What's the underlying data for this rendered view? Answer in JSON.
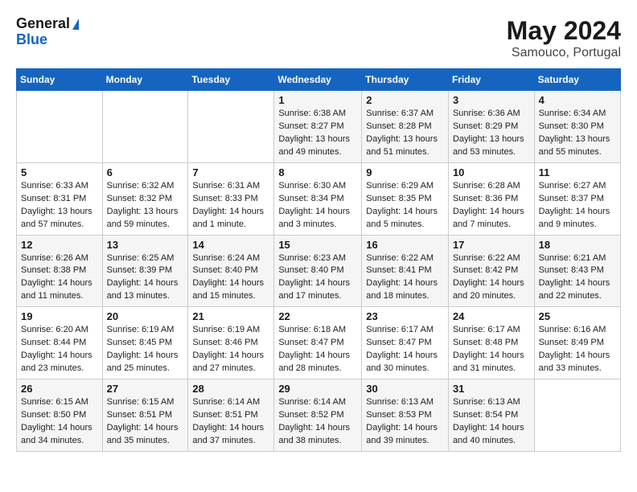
{
  "header": {
    "logo_line1": "General",
    "logo_line2": "Blue",
    "month_year": "May 2024",
    "location": "Samouco, Portugal"
  },
  "days_of_week": [
    "Sunday",
    "Monday",
    "Tuesday",
    "Wednesday",
    "Thursday",
    "Friday",
    "Saturday"
  ],
  "weeks": [
    [
      {
        "day": "",
        "info": ""
      },
      {
        "day": "",
        "info": ""
      },
      {
        "day": "",
        "info": ""
      },
      {
        "day": "1",
        "info": "Sunrise: 6:38 AM\nSunset: 8:27 PM\nDaylight: 13 hours\nand 49 minutes."
      },
      {
        "day": "2",
        "info": "Sunrise: 6:37 AM\nSunset: 8:28 PM\nDaylight: 13 hours\nand 51 minutes."
      },
      {
        "day": "3",
        "info": "Sunrise: 6:36 AM\nSunset: 8:29 PM\nDaylight: 13 hours\nand 53 minutes."
      },
      {
        "day": "4",
        "info": "Sunrise: 6:34 AM\nSunset: 8:30 PM\nDaylight: 13 hours\nand 55 minutes."
      }
    ],
    [
      {
        "day": "5",
        "info": "Sunrise: 6:33 AM\nSunset: 8:31 PM\nDaylight: 13 hours\nand 57 minutes."
      },
      {
        "day": "6",
        "info": "Sunrise: 6:32 AM\nSunset: 8:32 PM\nDaylight: 13 hours\nand 59 minutes."
      },
      {
        "day": "7",
        "info": "Sunrise: 6:31 AM\nSunset: 8:33 PM\nDaylight: 14 hours\nand 1 minute."
      },
      {
        "day": "8",
        "info": "Sunrise: 6:30 AM\nSunset: 8:34 PM\nDaylight: 14 hours\nand 3 minutes."
      },
      {
        "day": "9",
        "info": "Sunrise: 6:29 AM\nSunset: 8:35 PM\nDaylight: 14 hours\nand 5 minutes."
      },
      {
        "day": "10",
        "info": "Sunrise: 6:28 AM\nSunset: 8:36 PM\nDaylight: 14 hours\nand 7 minutes."
      },
      {
        "day": "11",
        "info": "Sunrise: 6:27 AM\nSunset: 8:37 PM\nDaylight: 14 hours\nand 9 minutes."
      }
    ],
    [
      {
        "day": "12",
        "info": "Sunrise: 6:26 AM\nSunset: 8:38 PM\nDaylight: 14 hours\nand 11 minutes."
      },
      {
        "day": "13",
        "info": "Sunrise: 6:25 AM\nSunset: 8:39 PM\nDaylight: 14 hours\nand 13 minutes."
      },
      {
        "day": "14",
        "info": "Sunrise: 6:24 AM\nSunset: 8:40 PM\nDaylight: 14 hours\nand 15 minutes."
      },
      {
        "day": "15",
        "info": "Sunrise: 6:23 AM\nSunset: 8:40 PM\nDaylight: 14 hours\nand 17 minutes."
      },
      {
        "day": "16",
        "info": "Sunrise: 6:22 AM\nSunset: 8:41 PM\nDaylight: 14 hours\nand 18 minutes."
      },
      {
        "day": "17",
        "info": "Sunrise: 6:22 AM\nSunset: 8:42 PM\nDaylight: 14 hours\nand 20 minutes."
      },
      {
        "day": "18",
        "info": "Sunrise: 6:21 AM\nSunset: 8:43 PM\nDaylight: 14 hours\nand 22 minutes."
      }
    ],
    [
      {
        "day": "19",
        "info": "Sunrise: 6:20 AM\nSunset: 8:44 PM\nDaylight: 14 hours\nand 23 minutes."
      },
      {
        "day": "20",
        "info": "Sunrise: 6:19 AM\nSunset: 8:45 PM\nDaylight: 14 hours\nand 25 minutes."
      },
      {
        "day": "21",
        "info": "Sunrise: 6:19 AM\nSunset: 8:46 PM\nDaylight: 14 hours\nand 27 minutes."
      },
      {
        "day": "22",
        "info": "Sunrise: 6:18 AM\nSunset: 8:47 PM\nDaylight: 14 hours\nand 28 minutes."
      },
      {
        "day": "23",
        "info": "Sunrise: 6:17 AM\nSunset: 8:47 PM\nDaylight: 14 hours\nand 30 minutes."
      },
      {
        "day": "24",
        "info": "Sunrise: 6:17 AM\nSunset: 8:48 PM\nDaylight: 14 hours\nand 31 minutes."
      },
      {
        "day": "25",
        "info": "Sunrise: 6:16 AM\nSunset: 8:49 PM\nDaylight: 14 hours\nand 33 minutes."
      }
    ],
    [
      {
        "day": "26",
        "info": "Sunrise: 6:15 AM\nSunset: 8:50 PM\nDaylight: 14 hours\nand 34 minutes."
      },
      {
        "day": "27",
        "info": "Sunrise: 6:15 AM\nSunset: 8:51 PM\nDaylight: 14 hours\nand 35 minutes."
      },
      {
        "day": "28",
        "info": "Sunrise: 6:14 AM\nSunset: 8:51 PM\nDaylight: 14 hours\nand 37 minutes."
      },
      {
        "day": "29",
        "info": "Sunrise: 6:14 AM\nSunset: 8:52 PM\nDaylight: 14 hours\nand 38 minutes."
      },
      {
        "day": "30",
        "info": "Sunrise: 6:13 AM\nSunset: 8:53 PM\nDaylight: 14 hours\nand 39 minutes."
      },
      {
        "day": "31",
        "info": "Sunrise: 6:13 AM\nSunset: 8:54 PM\nDaylight: 14 hours\nand 40 minutes."
      },
      {
        "day": "",
        "info": ""
      }
    ]
  ]
}
